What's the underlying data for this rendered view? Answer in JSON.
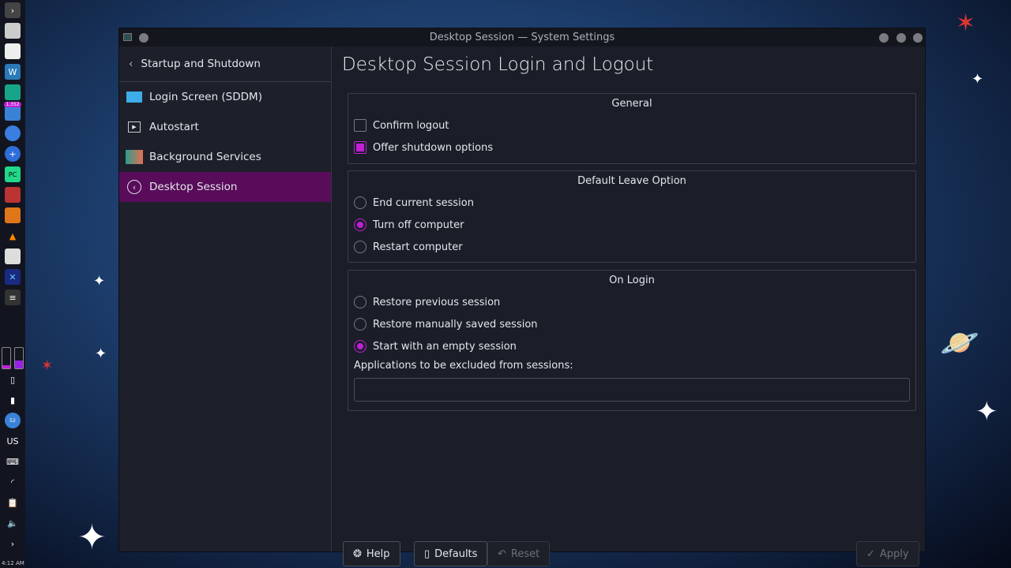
{
  "window": {
    "title": "Desktop Session — System Settings"
  },
  "sidebar": {
    "back_label": "Startup and Shutdown",
    "items": [
      {
        "label": "Login Screen (SDDM)"
      },
      {
        "label": "Autostart"
      },
      {
        "label": "Background Services"
      },
      {
        "label": "Desktop Session"
      }
    ]
  },
  "page": {
    "title": "Desktop Session Login and Logout"
  },
  "general": {
    "title": "General",
    "confirm_logout": "Confirm logout",
    "offer_shutdown": "Offer shutdown options"
  },
  "leave": {
    "title": "Default Leave Option",
    "end": "End current session",
    "off": "Turn off computer",
    "restart": "Restart computer"
  },
  "login": {
    "title": "On Login",
    "restore_prev": "Restore previous session",
    "restore_manual": "Restore manually saved session",
    "empty": "Start with an empty session",
    "exclude_label": "Applications to be excluded from sessions:",
    "exclude_value": ""
  },
  "buttons": {
    "help": "Help",
    "defaults": "Defaults",
    "reset": "Reset",
    "apply": "Apply"
  },
  "panel": {
    "badge": "1,352",
    "badge2": "52",
    "layout": "US",
    "clock": "4:12 AM"
  },
  "colors": {
    "accent": "#c21fd6",
    "selected": "#580c5a"
  }
}
